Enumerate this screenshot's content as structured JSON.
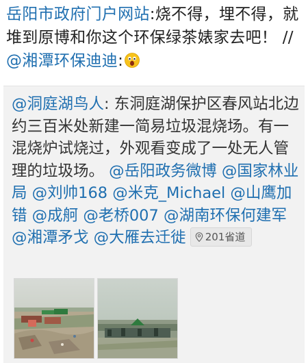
{
  "post": {
    "main_text_mention": "岳阳市政府门户网站",
    "main_text_body": ":烧不得，埋不得，就堆到原博和你这个环保绿茶婊家去吧！ //",
    "repost_mention": "@湘潭环保迪迪",
    "repost_suffix": ":",
    "emoji": "shocked-emoji"
  },
  "quote": {
    "author_mention": "@洞庭湖鸟人",
    "body": ": 东洞庭湖保护区春风站北边约三百米处新建一简易垃圾混烧场。有一混烧炉试烧过，外观看变成了一处无人管理的垃圾场。",
    "mentions": [
      "@岳阳政务微博",
      "@国家林业局",
      "@刘帅168",
      "@米克_Michael",
      "@山鹰加错",
      "@成舸",
      "@老桥007",
      "@湖南环保何建军",
      "@湘潭矛戈",
      "@大雁去迁徙"
    ],
    "location": {
      "icon": "location-pin-icon",
      "label": "201省道"
    },
    "photos": [
      {
        "name": "photo-thumbnail"
      },
      {
        "name": "photo-thumbnail"
      }
    ]
  },
  "colors": {
    "mention": "#1f6fb0",
    "text": "#222222",
    "card_bg": "#f2f2f2"
  }
}
